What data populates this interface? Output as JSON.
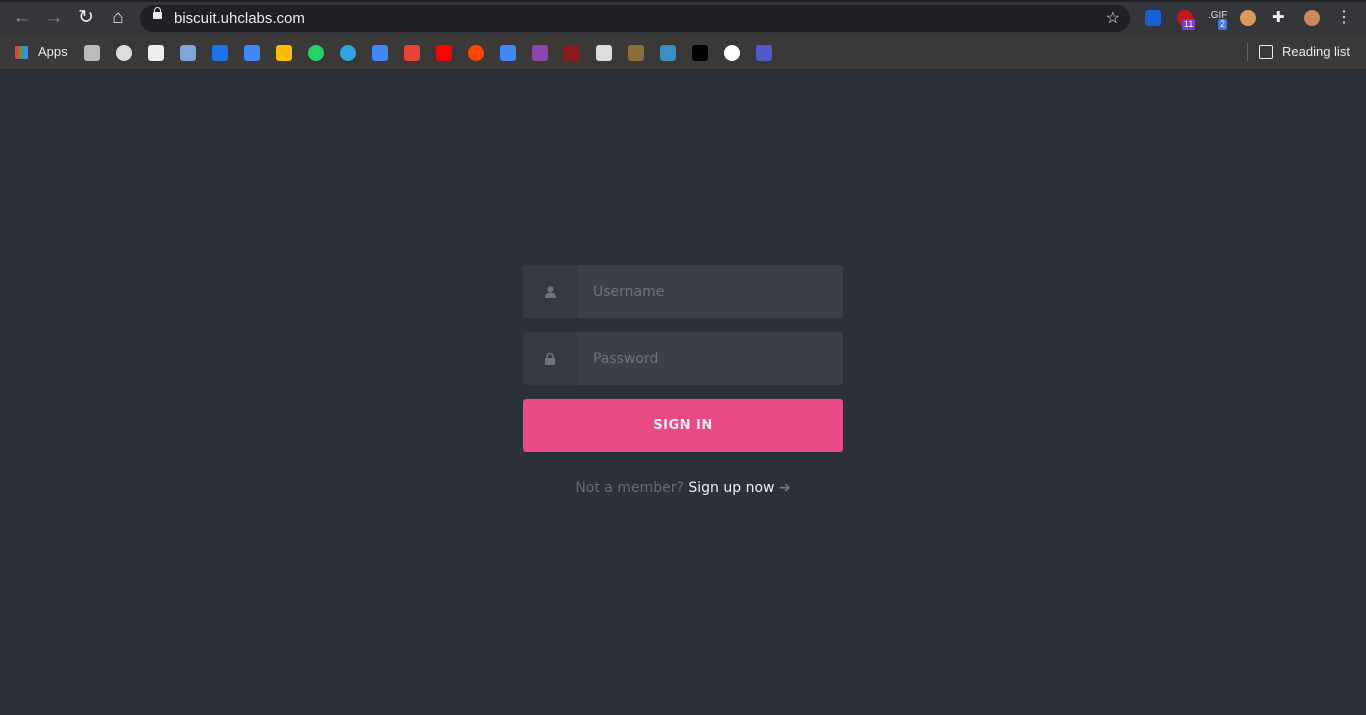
{
  "browser": {
    "url": "biscuit.uhclabs.com",
    "apps_label": "Apps",
    "reading_list_label": "Reading list",
    "extension_badges": [
      "11",
      "2"
    ],
    "bookmark_icons": [
      "folder-icon",
      "history-icon",
      "download-icon",
      "wizard-icon",
      "google-calendar-icon",
      "google-docs-icon",
      "google-keep-icon",
      "whatsapp-icon",
      "telegram-icon",
      "google-slides-icon",
      "gmail-icon",
      "youtube-icon",
      "reddit-icon",
      "google-translate-icon",
      "color-grid-icon",
      "hash-icon",
      "chef-hat-icon",
      "robot-icon",
      "game-icon",
      "ifttt-icon",
      "sg-icon",
      "teams-icon"
    ]
  },
  "login": {
    "username_placeholder": "Username",
    "password_placeholder": "Password",
    "sign_in_label": "SIGN IN",
    "not_member": "Not a member?",
    "sign_up_label": "Sign up now",
    "arrow": "➔"
  },
  "colors": {
    "accent": "#ea4b86",
    "background": "#2c3139"
  }
}
